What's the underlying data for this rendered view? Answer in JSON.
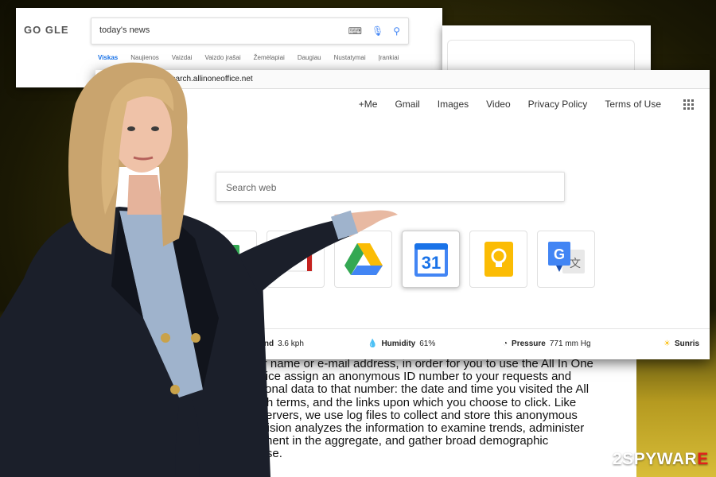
{
  "google_window": {
    "logo": "GO GLE",
    "query": "today's news",
    "tabs": [
      "Viskas",
      "Naujienos",
      "Vaizdai",
      "Vaizdo įrašai",
      "Žemėlapiai",
      "Daugiau",
      "Nustatymai",
      "Įrankiai"
    ],
    "active_tab_index": 0
  },
  "browser": {
    "url": "search.allinoneoffice.net"
  },
  "nav": {
    "items": [
      "+Me",
      "Gmail",
      "Images",
      "Video",
      "Privacy Policy",
      "Terms of Use"
    ],
    "apps_icon": "apps-grid-icon"
  },
  "search": {
    "placeholder": "Search web"
  },
  "shortcuts": [
    {
      "name": "sheets-icon"
    },
    {
      "name": "gmail-icon"
    },
    {
      "name": "drive-icon"
    },
    {
      "name": "calendar-icon",
      "label": "31"
    },
    {
      "name": "keep-icon"
    },
    {
      "name": "translate-icon",
      "label": "G"
    }
  ],
  "weather": {
    "wind_label": "Wind",
    "wind_value": "3.6 kph",
    "humidity_label": "Humidity",
    "humidity_value": "61%",
    "pressure_label": "Pressure",
    "pressure_value": "771 mm Hg",
    "sunrise_label": "Sunris"
  },
  "policy_lines": [
    "our name or e-mail address, in order for you to use the All In One",
    "Office assign an anonymous ID number to your requests and",
    "ditional data to that number: the date and time you visited the All",
    "arch terms, and the links upon which you choose to click. Like",
    "e servers, we use log files to collect and store this anonymous",
    "Division analyzes the information to examine trends, administer",
    "vement in the aggregate, and gather broad demographic",
    "e use."
  ],
  "watermark": {
    "num": "2",
    "brand_white": "SPYWAR",
    "brand_red": "E"
  },
  "colors": {
    "google_blue": "#4285f4",
    "google_red": "#ea4335",
    "google_yellow": "#fbbc04",
    "google_green": "#34a853",
    "watermark_red": "#e2211c"
  }
}
